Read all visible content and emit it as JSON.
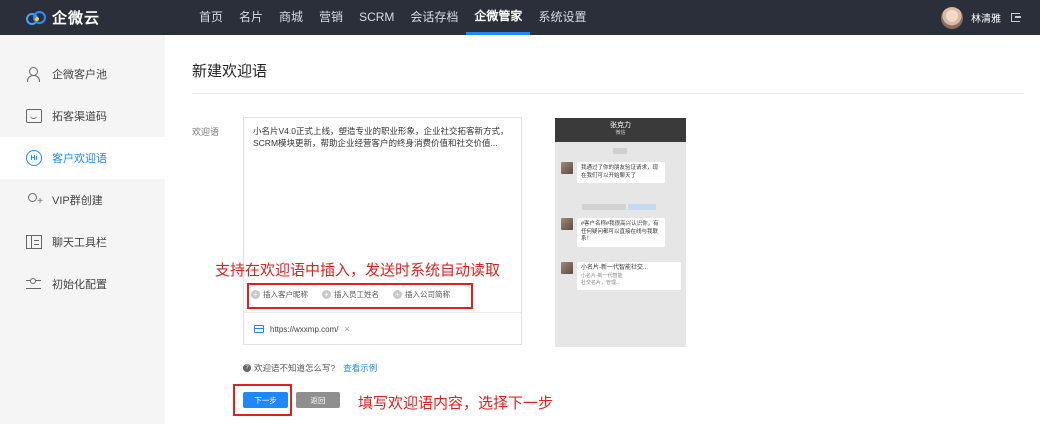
{
  "app": {
    "logo_text": "企微云"
  },
  "nav": {
    "items": [
      {
        "label": "首页"
      },
      {
        "label": "名片"
      },
      {
        "label": "商城"
      },
      {
        "label": "营销"
      },
      {
        "label": "SCRM"
      },
      {
        "label": "会话存档"
      },
      {
        "label": "企微管家",
        "active": true
      },
      {
        "label": "系统设置"
      }
    ]
  },
  "user": {
    "name": "林清雅"
  },
  "sidebar": {
    "items": [
      {
        "label": "企微客户池",
        "icon": "customer-pool-icon"
      },
      {
        "label": "拓客渠道码",
        "icon": "channel-code-icon"
      },
      {
        "label": "客户欢迎语",
        "icon": "welcome-hi-icon",
        "active": true
      },
      {
        "label": "VIP群创建",
        "icon": "group-add-icon"
      },
      {
        "label": "聊天工具栏",
        "icon": "toolbar-book-icon"
      },
      {
        "label": "初始化配置",
        "icon": "sliders-icon"
      }
    ]
  },
  "main": {
    "title": "新建欢迎语",
    "field_label": "欢迎语",
    "editor_text": "小名片V4.0正式上线，塑造专业的职业形象，企业社交拓客新方式，SCRM模块更新，帮助企业经营客户的终身消费价值和社交价值...",
    "insert_buttons": [
      "插入客户昵称",
      "插入员工姓名",
      "插入公司简称"
    ],
    "link_url": "https://wxxmp.com/",
    "link_close": "×",
    "hint_text": "欢迎语不知道怎么写?",
    "hint_link": "查看示例",
    "next_button": "下一步",
    "back_button": "返回"
  },
  "annotations": {
    "insert_note": "支持在欢迎语中插入，发送时系统自动读取",
    "next_note": "填写欢迎语内容，选择下一步",
    "color": "#e21f1f"
  },
  "preview": {
    "contact_name": "张克力",
    "contact_sub": "微信",
    "msg1": "我通过了你的朋友验证请求，现在我们可以开始聊天了",
    "msg2": "#客户名称#我很高兴认识你，有任何疑问都可以直接在线与我联系！",
    "card_title": "小名片-新一代智能社交...",
    "card_line1": "小名片-新一代智能",
    "card_line2": "社交名片，管理..."
  },
  "colors": {
    "accent": "#1e88ff",
    "topbar": "#2b2f3a",
    "sidebar_bg": "#f5f5f6"
  }
}
